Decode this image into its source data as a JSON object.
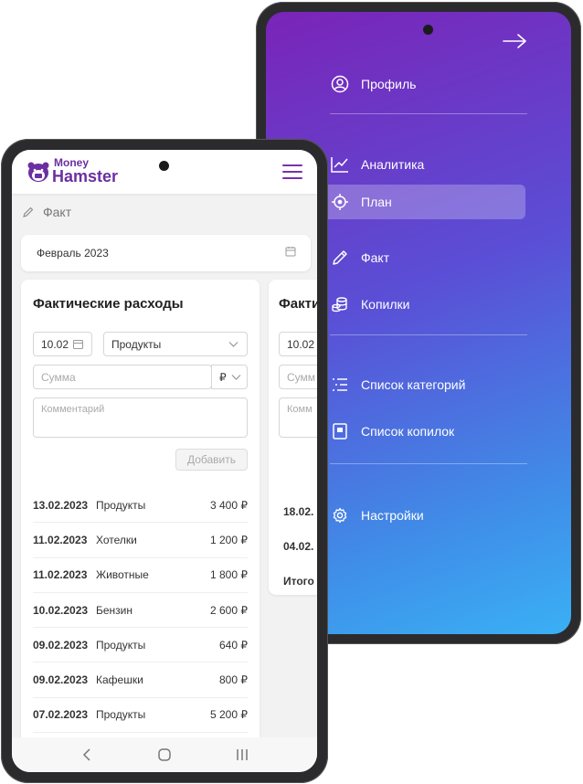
{
  "menu": {
    "close_icon": "arrow-right-icon",
    "items": [
      {
        "label": "Профиль",
        "icon": "user-circle-icon"
      },
      {
        "label": "Аналитика",
        "icon": "chart-line-icon"
      },
      {
        "label": "План",
        "icon": "target-icon",
        "active": true
      },
      {
        "label": "Факт",
        "icon": "pencil-icon"
      },
      {
        "label": "Копилки",
        "icon": "coins-icon"
      },
      {
        "label": "Список категорий",
        "icon": "list-icon"
      },
      {
        "label": "Список копилок",
        "icon": "book-icon"
      },
      {
        "label": "Настройки",
        "icon": "gear-icon"
      }
    ]
  },
  "app": {
    "logo_line1": "Money",
    "logo_line2": "Hamster",
    "breadcrumb": "Факт",
    "month": "Февраль 2023"
  },
  "form": {
    "title": "Фактические расходы",
    "date": "10.02",
    "category": "Продукты",
    "amount_placeholder": "Сумма",
    "currency": "₽",
    "comment_placeholder": "Комментарий",
    "add_button": "Добавить"
  },
  "expenses": [
    {
      "date": "13.02.2023",
      "category": "Продукты",
      "amount": "3 400 ₽"
    },
    {
      "date": "11.02.2023",
      "category": "Хотелки",
      "amount": "1 200 ₽"
    },
    {
      "date": "11.02.2023",
      "category": "Животные",
      "amount": "1 800 ₽"
    },
    {
      "date": "10.02.2023",
      "category": "Бензин",
      "amount": "2 600 ₽"
    },
    {
      "date": "09.02.2023",
      "category": "Продукты",
      "amount": "640 ₽"
    },
    {
      "date": "09.02.2023",
      "category": "Кафешки",
      "amount": "800 ₽"
    },
    {
      "date": "07.02.2023",
      "category": "Продукты",
      "amount": "5 200 ₽"
    }
  ],
  "second_card": {
    "title": "Факти",
    "date": "10.02",
    "amount_placeholder": "Сумм",
    "comment_placeholder": "Комм",
    "rows": [
      "18.02.",
      "04.02.",
      "Итого"
    ]
  },
  "colors": {
    "brand": "#6b2fa0",
    "menu_gradient_top": "#7a24b8",
    "menu_gradient_bottom": "#3ab0f5"
  }
}
